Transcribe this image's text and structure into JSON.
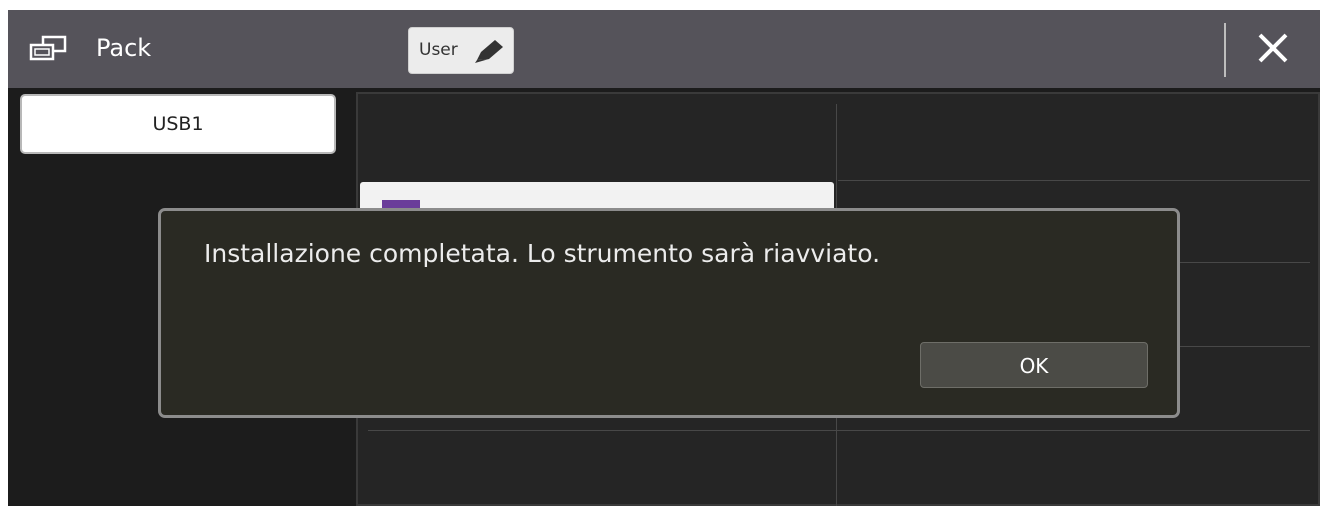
{
  "header": {
    "title": "Pack",
    "title_icon": "pack-icon",
    "user_button_label": "User",
    "user_button_icon": "pencil-icon",
    "close_icon": "close-icon"
  },
  "sidebar": {
    "items": [
      {
        "label": "USB1",
        "selected": true
      }
    ]
  },
  "dialog": {
    "message": "Installazione completata. Lo strumento sarà riavviato.",
    "ok_label": "OK"
  },
  "colors": {
    "titlebar": "#55535a",
    "background": "#1c1c1c",
    "dialog_bg": "#2a2a23",
    "list_swatch": "#6a3d9a"
  }
}
